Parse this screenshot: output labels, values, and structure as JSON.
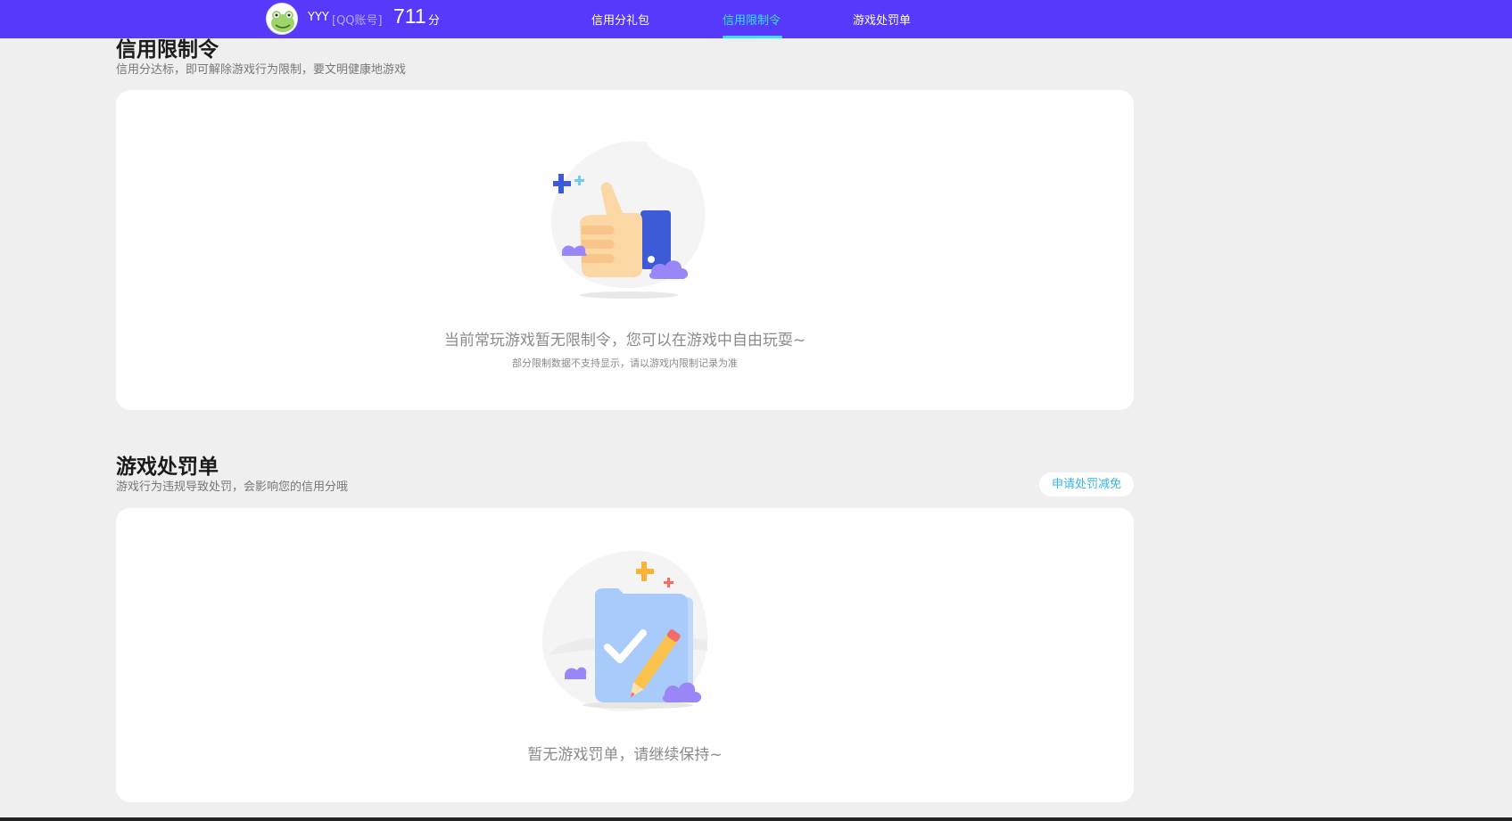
{
  "header": {
    "user_name": "YYY",
    "account_type": "[QQ账号]",
    "score": "711",
    "score_unit": "分",
    "tabs": [
      {
        "label": "信用分礼包",
        "active": false
      },
      {
        "label": "信用限制令",
        "active": true
      },
      {
        "label": "游戏处罚单",
        "active": false
      }
    ],
    "colors": {
      "bar": "#5639fb",
      "active_tab": "#35e0ff"
    }
  },
  "restriction": {
    "title": "信用限制令",
    "subtitle": "信用分达标，即可解除游戏行为限制，要文明健康地游戏",
    "empty_text": "当前常玩游戏暂无限制令，您可以在游戏中自由玩耍~",
    "note": "部分限制数据不支持显示，请以游戏内限制记录为准",
    "illustration_icon": "thumbs-up-icon"
  },
  "penalty": {
    "title": "游戏处罚单",
    "subtitle": "游戏行为违规导致处罚，会影响您的信用分哦",
    "appeal_button": "申请处罚减免",
    "empty_text": "暂无游戏罚单，请继续保持~",
    "illustration_icon": "document-check-icon"
  }
}
